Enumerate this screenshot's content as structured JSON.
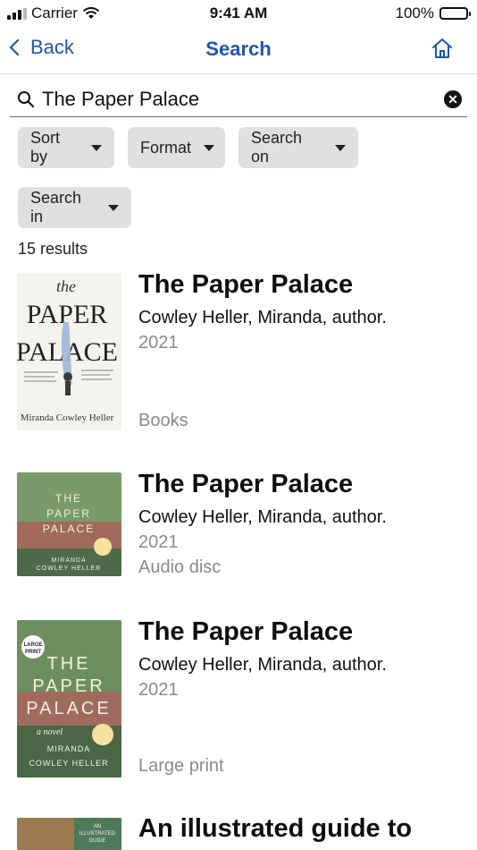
{
  "status": {
    "carrier": "Carrier",
    "time": "9:41 AM",
    "battery": "100%"
  },
  "nav": {
    "back_label": "Back",
    "title": "Search"
  },
  "search": {
    "query": "The Paper Palace"
  },
  "filters": {
    "sort_by": "Sort by",
    "format": "Format",
    "search_on": "Search on",
    "search_in": "Search in"
  },
  "results_count": "15 results",
  "results": [
    {
      "title": "The Paper Palace",
      "author": "Cowley Heller, Miranda, author.",
      "year": "2021",
      "format": "Books",
      "cover": {
        "the": "the",
        "line1": "PAPER",
        "line2": "PALACE",
        "author": "Miranda Cowley Heller"
      }
    },
    {
      "title": "The Paper Palace",
      "author": "Cowley Heller, Miranda, author.",
      "year": "2021",
      "format": "Audio disc",
      "cover": {
        "line1": "THE",
        "line2": "PAPER",
        "line3": "PALACE",
        "author1": "MIRANDA",
        "author2": "COWLEY HELLER"
      }
    },
    {
      "title": "The Paper Palace",
      "author": "Cowley Heller, Miranda, author.",
      "year": "2021",
      "format": "Large print",
      "cover": {
        "badge1": "LARGE",
        "badge2": "PRINT",
        "line1": "THE",
        "line2": "PAPER",
        "line3": "PALACE",
        "novel": "a novel",
        "author1": "MIRANDA",
        "author2": "COWLEY HELLER"
      }
    },
    {
      "title": "An illustrated guide to",
      "cover": {
        "line1": "AN",
        "line2": "ILLUSTRATED",
        "line3": "GUIDE"
      }
    }
  ],
  "colors": {
    "accent": "#1e56b0",
    "chip": "#e0e0e0",
    "muted": "#8a8a8a"
  }
}
